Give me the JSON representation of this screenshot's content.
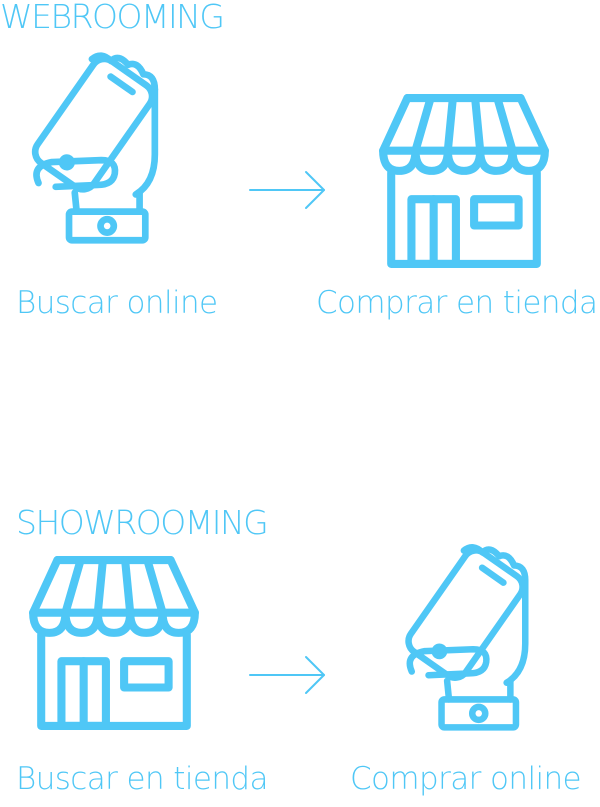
{
  "accent_color": "#4FC7F6",
  "webrooming": {
    "title": "WEBROOMING",
    "from_caption": "Buscar online",
    "to_caption": "Comprar en tienda",
    "from_icon": "phone-in-hand-icon",
    "to_icon": "store-icon",
    "arrow_icon": "arrow-right-icon"
  },
  "showrooming": {
    "title": "SHOWROOMING",
    "from_caption": "Buscar en tienda",
    "to_caption": "Comprar online",
    "from_icon": "store-icon",
    "to_icon": "phone-in-hand-icon",
    "arrow_icon": "arrow-right-icon"
  }
}
